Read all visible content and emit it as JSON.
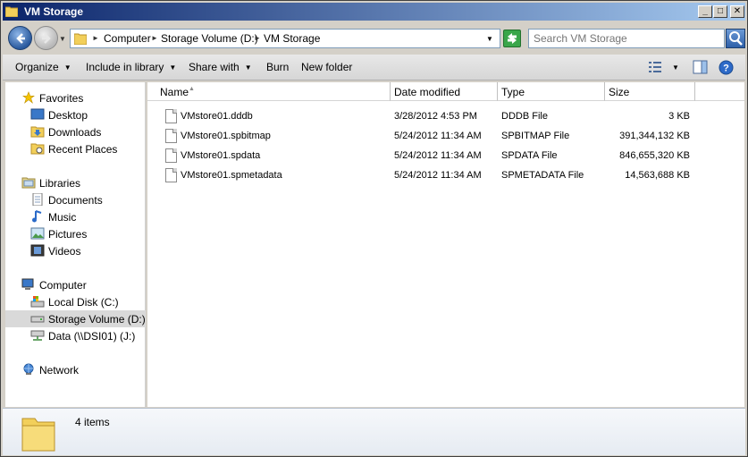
{
  "window": {
    "title": "VM Storage"
  },
  "titlebar_buttons": {
    "minimize": "_",
    "maximize": "□",
    "close": "✕"
  },
  "address": {
    "crumbs": [
      "Computer",
      "Storage Volume (D:)",
      "VM Storage"
    ]
  },
  "search": {
    "placeholder": "Search VM Storage"
  },
  "commands": {
    "organize": "Organize",
    "include_in_library": "Include in library",
    "share_with": "Share with",
    "burn": "Burn",
    "new_folder": "New folder"
  },
  "nav": {
    "favorites": "Favorites",
    "desktop": "Desktop",
    "downloads": "Downloads",
    "recent_places": "Recent Places",
    "libraries": "Libraries",
    "documents": "Documents",
    "music": "Music",
    "pictures": "Pictures",
    "videos": "Videos",
    "computer": "Computer",
    "local_disk": "Local Disk (C:)",
    "storage_volume": "Storage Volume (D:)",
    "data_share": "Data (\\\\DSI01) (J:)",
    "network": "Network"
  },
  "columns": {
    "name": "Name",
    "date_modified": "Date modified",
    "type": "Type",
    "size": "Size"
  },
  "files": [
    {
      "name": "VMstore01.dddb",
      "date": "3/28/2012 4:53 PM",
      "type": "DDDB File",
      "size": "3 KB"
    },
    {
      "name": "VMstore01.spbitmap",
      "date": "5/24/2012 11:34 AM",
      "type": "SPBITMAP File",
      "size": "391,344,132 KB"
    },
    {
      "name": "VMstore01.spdata",
      "date": "5/24/2012 11:34 AM",
      "type": "SPDATA File",
      "size": "846,655,320 KB"
    },
    {
      "name": "VMstore01.spmetadata",
      "date": "5/24/2012 11:34 AM",
      "type": "SPMETADATA File",
      "size": "14,563,688 KB"
    }
  ],
  "status": {
    "item_count": "4 items"
  }
}
